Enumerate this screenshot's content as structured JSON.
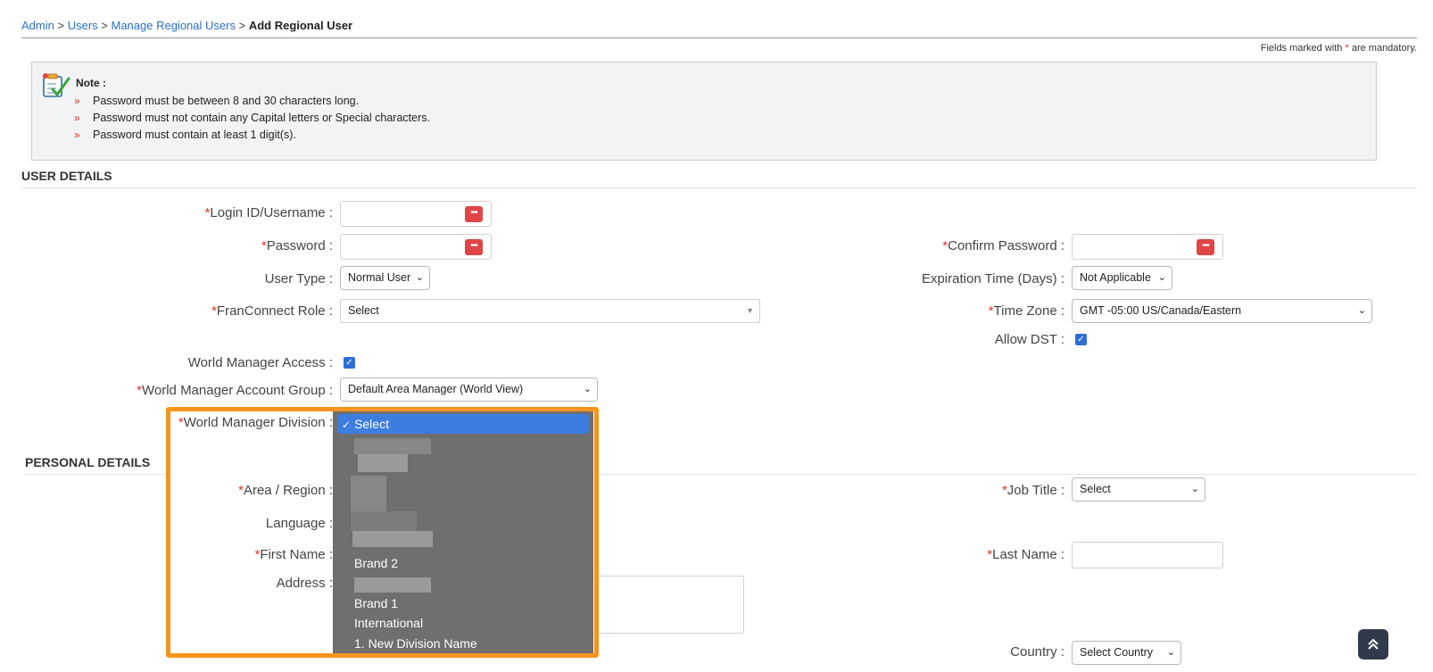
{
  "breadcrumb": {
    "items": [
      "Admin",
      "Users",
      "Manage Regional Users"
    ],
    "separator": ">",
    "current": "Add Regional User"
  },
  "mandatory_note": {
    "prefix": "Fields marked with",
    "star": "*",
    "suffix": "are mandatory."
  },
  "note": {
    "title": "Note :",
    "bullet": "»",
    "items": [
      "Password must be between 8 and 30 characters long.",
      "Password must not contain any Capital letters or Special characters.",
      "Password must contain at least 1 digit(s)."
    ]
  },
  "sections": {
    "user_details": "USER DETAILS",
    "personal_details": "PERSONAL DETAILS"
  },
  "required_mark": "*",
  "user_details": {
    "login_label": "Login ID/Username :",
    "password_label": "Password :",
    "confirm_password_label": "Confirm Password :",
    "user_type_label": "User Type :",
    "user_type_value": "Normal User",
    "expiration_label": "Expiration Time (Days) :",
    "expiration_value": "Not Applicable",
    "role_label": "FranConnect Role :",
    "role_value": "Select",
    "timezone_label": "Time Zone :",
    "timezone_value": "GMT -05:00 US/Canada/Eastern",
    "allow_dst_label": "Allow DST :",
    "allow_dst_checked": true,
    "wm_access_label": "World Manager Access :",
    "wm_access_checked": true,
    "wm_group_label": "World Manager Account Group :",
    "wm_group_value": "Default Area Manager (World View)",
    "wm_division_label": "World Manager Division :"
  },
  "division_dropdown": {
    "selected": "Select",
    "options": [
      "Brand 2",
      "Brand 1",
      "International",
      "1. New Division Name"
    ]
  },
  "personal_details": {
    "area_label": "Area / Region :",
    "language_label": "Language :",
    "first_name_label": "First Name :",
    "address_label": "Address :",
    "job_title_label": "Job Title :",
    "job_title_value": "Select",
    "last_name_label": "Last Name :",
    "country_label": "Country :",
    "country_value": "Select Country"
  },
  "icons": {
    "note": "note-checklist-icon",
    "password": "password-dots-icon",
    "scroll_top": "double-chevron-up-icon"
  },
  "colors": {
    "link": "#2a6fc9",
    "required": "#e0302a",
    "highlight": "#f7941d",
    "dropdown_bg": "#6f6f6f",
    "dropdown_selected": "#3d7de0"
  }
}
